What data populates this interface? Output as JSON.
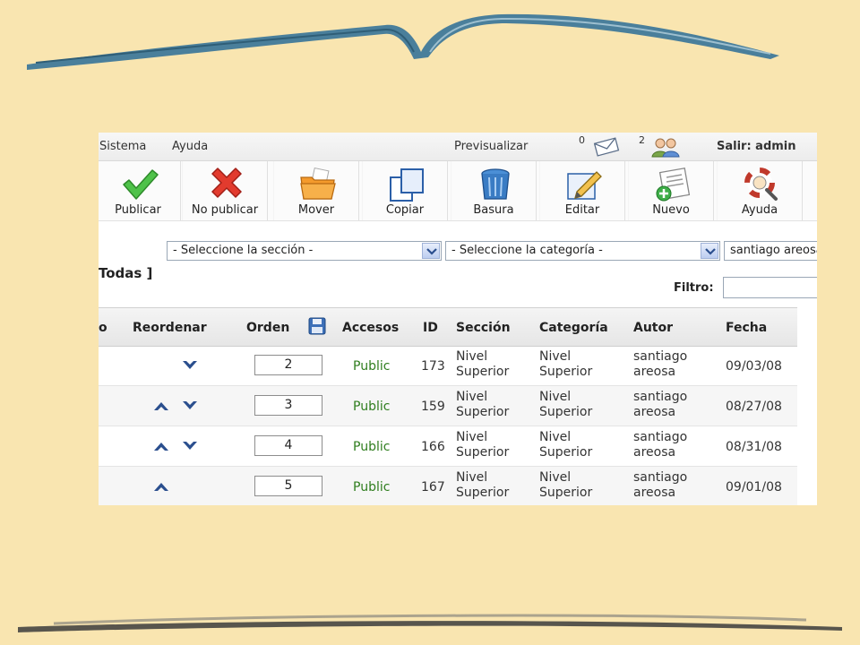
{
  "menubar": {
    "sistema": "Sistema",
    "ayuda": "Ayuda",
    "previsualizar": "Previsualizar",
    "messages_count": "0",
    "users_count": "2",
    "salir": "Salir: admin"
  },
  "toolbar": {
    "publicar": "Publicar",
    "no_publicar": "No publicar",
    "mover": "Mover",
    "copiar": "Copiar",
    "basura": "Basura",
    "editar": "Editar",
    "nuevo": "Nuevo",
    "ayuda": "Ayuda"
  },
  "filters": {
    "seccion": "- Seleccione la sección -",
    "categoria": "- Seleccione la categoría -",
    "autor": "santiago areosa",
    "todas": "Todas ]",
    "filtro_label": "Filtro:"
  },
  "table": {
    "columns": {
      "partial": "o",
      "reordenar": "Reordenar",
      "orden": "Orden",
      "accesos": "Accesos",
      "id": "ID",
      "seccion": "Sección",
      "categoria": "Categoría",
      "autor": "Autor",
      "fecha": "Fecha"
    },
    "rows": [
      {
        "up": false,
        "down": true,
        "orden": "2",
        "acceso": "Public",
        "id": "173",
        "seccion_1": "Nivel",
        "seccion_2": "Superior",
        "categoria_1": "Nivel",
        "categoria_2": "Superior",
        "autor_1": "santiago",
        "autor_2": "areosa",
        "fecha": "09/03/08"
      },
      {
        "up": true,
        "down": true,
        "orden": "3",
        "acceso": "Public",
        "id": "159",
        "seccion_1": "Nivel",
        "seccion_2": "Superior",
        "categoria_1": "Nivel",
        "categoria_2": "Superior",
        "autor_1": "santiago",
        "autor_2": "areosa",
        "fecha": "08/27/08"
      },
      {
        "up": true,
        "down": true,
        "orden": "4",
        "acceso": "Public",
        "id": "166",
        "seccion_1": "Nivel",
        "seccion_2": "Superior",
        "categoria_1": "Nivel",
        "categoria_2": "Superior",
        "autor_1": "santiago",
        "autor_2": "areosa",
        "fecha": "08/31/08"
      },
      {
        "up": true,
        "down": false,
        "orden": "5",
        "acceso": "Public",
        "id": "167",
        "seccion_1": "Nivel",
        "seccion_2": "Superior",
        "categoria_1": "Nivel",
        "categoria_2": "Superior",
        "autor_1": "santiago",
        "autor_2": "areosa",
        "fecha": "09/01/08"
      }
    ]
  },
  "colors": {
    "slide_background": "#f9e5b0",
    "access_green": "#2e7d1d",
    "arrow_blue": "#2b4f8e"
  }
}
